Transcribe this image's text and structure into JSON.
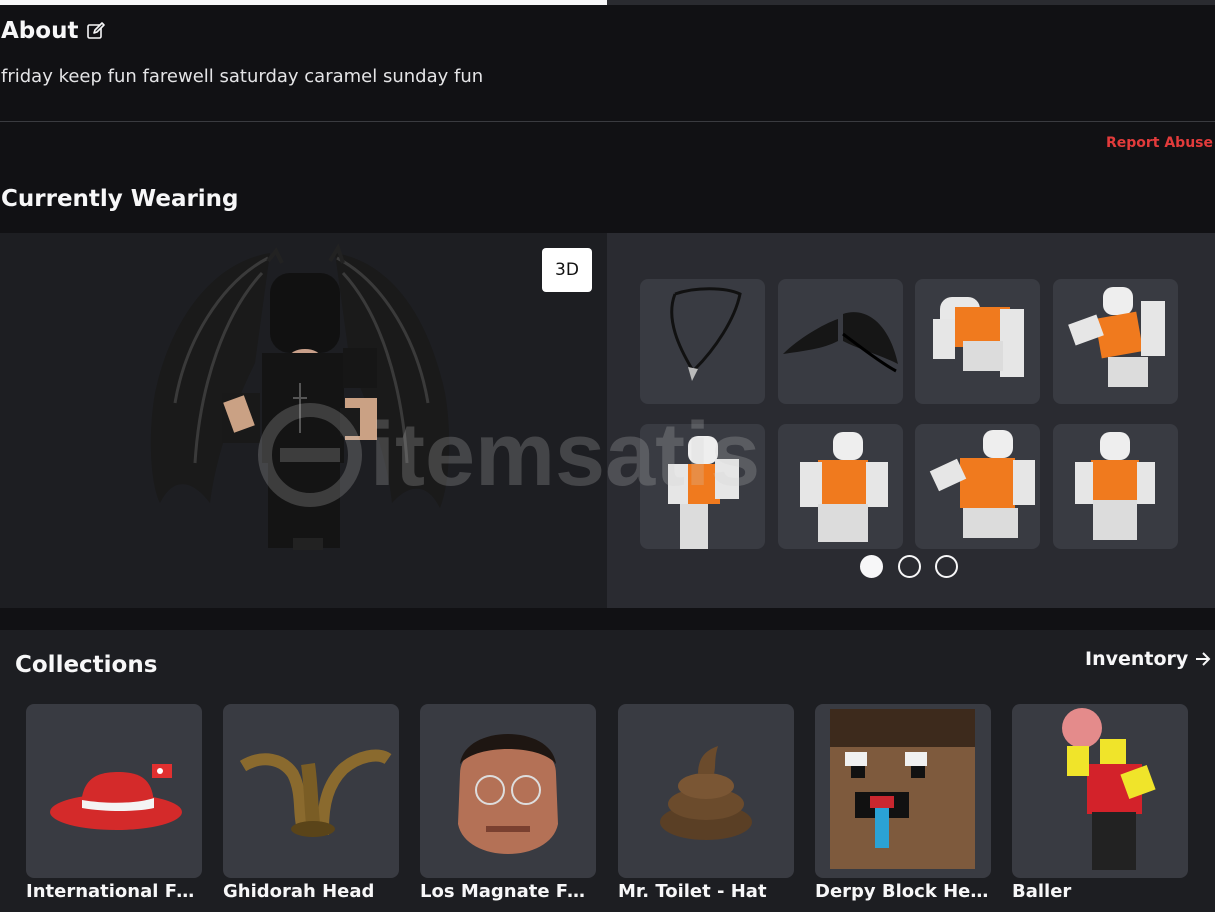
{
  "about": {
    "title": "About",
    "description": "friday keep fun farewell saturday caramel sunday fun",
    "report_label": "Report Abuse"
  },
  "currently_wearing": {
    "title": "Currently Wearing",
    "view_toggle_label": "3D",
    "items": [
      {
        "icon": "necklace"
      },
      {
        "icon": "black-wings"
      },
      {
        "icon": "animation-pose"
      },
      {
        "icon": "animation-pose"
      },
      {
        "icon": "animation-pose"
      },
      {
        "icon": "animation-pose"
      },
      {
        "icon": "animation-pose"
      },
      {
        "icon": "animation-pose"
      }
    ],
    "pages": 3,
    "current_page": 1
  },
  "collections": {
    "title": "Collections",
    "inventory_label": "Inventory",
    "items": [
      {
        "name": "International Fed..."
      },
      {
        "name": "Ghidorah Head"
      },
      {
        "name": "Los Magnate Fac..."
      },
      {
        "name": "Mr. Toilet - Hat"
      },
      {
        "name": "Derpy Block Head"
      },
      {
        "name": "Baller"
      }
    ]
  },
  "watermark": {
    "text": "itemsatis"
  },
  "colors": {
    "background": "#111114",
    "panel": "#1d1e22",
    "tile": "#393b42",
    "report": "#e23b3b",
    "orange": "#f07a1e"
  }
}
